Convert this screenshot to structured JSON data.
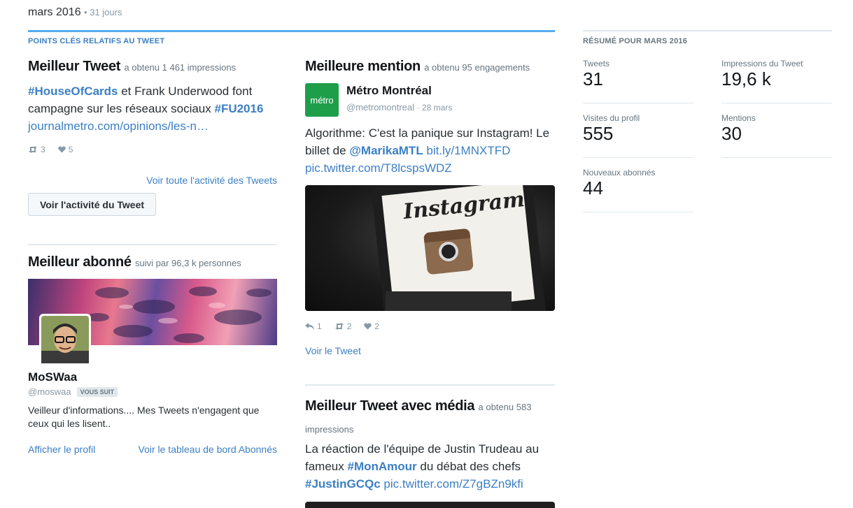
{
  "header": {
    "title": "mars 2016",
    "meta": "• 31 jours"
  },
  "highlights": {
    "kicker": "POINTS CLÉS RELATIFS AU TWEET",
    "top_tweet": {
      "title": "Meilleur Tweet",
      "subtitle": "a obtenu 1 461 impressions",
      "hashtag1": "#HouseOfCards",
      "text1": " et Frank Underwood font campagne sur les réseaux sociaux ",
      "hashtag2": "#FU2016",
      "link": "journalmetro.com/opinions/les-n…",
      "retweets": "3",
      "likes": "5",
      "all_activity_link": "Voir toute l'activité des Tweets",
      "button": "Voir l'activité du Tweet"
    },
    "top_follower": {
      "title": "Meilleur abonné",
      "subtitle": "suivi par 96,3 k personnes",
      "name": "MoSWaa",
      "handle": "@moswaa",
      "badge": "VOUS SUIT",
      "bio": "Veilleur d'informations.... Mes Tweets n'engagent que ceux qui les lisent..",
      "profile_link": "Afficher le profil",
      "dashboard_link": "Voir le tableau de bord Abonnés"
    },
    "top_mention": {
      "title": "Meilleure mention",
      "subtitle": "a obtenu 95 engagements",
      "avatar_text": "métro",
      "author": "Métro Montréal",
      "handle": "@metromontreal",
      "date": "· 28 mars",
      "text1": "Algorithme: C'est la panique sur Instagram! Le billet de ",
      "mention": "@MarikaMTL",
      "link1": " bit.ly/1MNXTFD",
      "link2": "pic.twitter.com/T8lcspsWDZ",
      "image_text": "Instagram",
      "replies": "1",
      "retweets": "2",
      "likes": "2",
      "view_link": "Voir le Tweet"
    },
    "top_media_tweet": {
      "title": "Meilleur Tweet avec média",
      "subtitle": "a obtenu 583",
      "subtitle2": "impressions",
      "text1": "La réaction de l'équipe de Justin Trudeau au fameux ",
      "hashtag1": "#MonAmour",
      "text2": " du débat des chefs ",
      "hashtag2": "#JustinGCQc",
      "link": " pic.twitter.com/Z7gBZn9kfi"
    }
  },
  "summary": {
    "kicker": "RÉSUMÉ POUR MARS 2016",
    "tweets_label": "Tweets",
    "tweets_value": "31",
    "impressions_label": "Impressions du Tweet",
    "impressions_value": "19,6 k",
    "visits_label": "Visites du profil",
    "visits_value": "555",
    "mentions_label": "Mentions",
    "mentions_value": "30",
    "followers_label": "Nouveaux abonnés",
    "followers_value": "44"
  }
}
